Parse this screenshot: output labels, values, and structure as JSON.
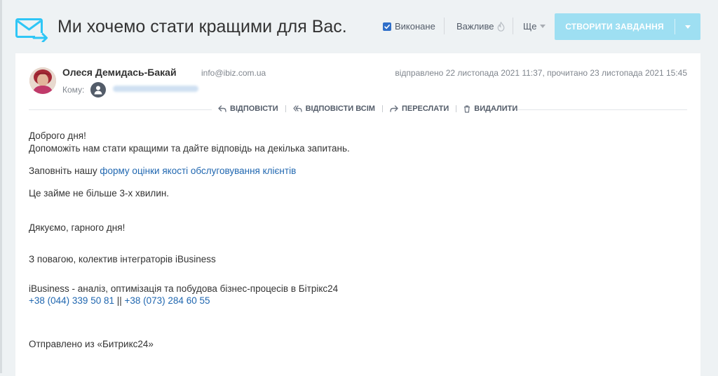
{
  "header": {
    "title": "Ми хочемо стати кращими для Вас.",
    "done_label": "Виконане",
    "done_checked": true,
    "important_label": "Важливе",
    "more_label": "Ще",
    "create_task_label": "СТВОРИТИ ЗАВДАННЯ",
    "icons": [
      "mail-forward-icon",
      "checkbox-icon",
      "flame-icon",
      "chevron-down-icon"
    ]
  },
  "message": {
    "sender_name": "Олеся Демидась-Бакай",
    "sender_email": "info@ibiz.com.ua",
    "sent_info": "відправлено 22 листопада 2021 11:37, прочитано 23 листопада 2021 15:45",
    "to_label": "Кому:",
    "actions": {
      "reply": "ВІДПОВІСТИ",
      "reply_all": "ВІДПОВІСТИ ВСІМ",
      "forward": "ПЕРЕСЛАТИ",
      "delete": "ВИДАЛИТИ"
    },
    "body": {
      "greeting": "Доброго дня!",
      "request": "Допоможіть нам стати кращими та дайте відповідь на декілька запитань.",
      "fill_prefix": "Заповніть нашу ",
      "fill_link": "форму оцінки якості обслуговування клієнтів",
      "duration": "Це займе не більше 3-х хвилин.",
      "thanks": "Дякуємо, гарного дня!",
      "regards": "З повагою, колектив інтеграторів iBusiness",
      "company": "iBusiness - аналіз, оптимізація та побудова бізнес-процесів в Бітрікс24",
      "phone1": "+38 (044) 339 50 81",
      "phone_sep": " || ",
      "phone2": "+38 (073) 284 60 55",
      "footer": "Отправлено из «Битрикс24»"
    }
  },
  "colors": {
    "accent": "#2067b0",
    "button": "#9edff2",
    "icon_blue": "#2fc6f6",
    "background": "#eef2f4"
  }
}
